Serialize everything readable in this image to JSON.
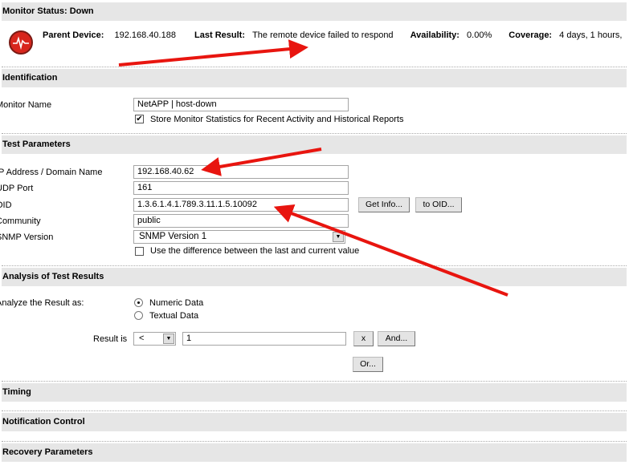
{
  "status": {
    "title": "Monitor Status: Down",
    "parent_label": "Parent Device:",
    "parent_value": "192.168.40.188",
    "last_label": "Last Result:",
    "last_value": "The remote device failed to respond",
    "avail_label": "Availability:",
    "avail_value": "0.00%",
    "cov_label": "Coverage:",
    "cov_value": "4 days, 1 hours,"
  },
  "identification": {
    "title": "Identification",
    "name_label": "Monitor Name",
    "name_value": "NetAPP | host-down",
    "store_label": "Store Monitor Statistics for Recent Activity and Historical Reports",
    "store_checked": true
  },
  "test": {
    "title": "Test Parameters",
    "ip_label": "IP Address / Domain Name",
    "ip_value": "192.168.40.62",
    "port_label": "UDP Port",
    "port_value": "161",
    "oid_label": "OID",
    "oid_value": "1.3.6.1.4.1.789.3.11.1.5.10092",
    "getinfo": "Get Info...",
    "tooid": "to OID...",
    "community_label": "Community",
    "community_value": "public",
    "snmp_label": "SNMP Version",
    "snmp_value": "SNMP Version 1",
    "diff_label": "Use the difference between the last and current value",
    "diff_checked": false
  },
  "analysis": {
    "title": "Analysis of Test Results",
    "as_label": "Analyze the Result as:",
    "numeric": "Numeric Data",
    "textual": "Textual Data",
    "result_label": "Result is",
    "op_value": "<",
    "result_value": "1",
    "x_btn": "x",
    "and_btn": "And...",
    "or_btn": "Or..."
  },
  "sections": {
    "timing": "Timing",
    "notification": "Notification Control",
    "recovery": "Recovery Parameters"
  },
  "colors": {
    "arrow": "#e8150f",
    "header": "#e6e6e6"
  }
}
